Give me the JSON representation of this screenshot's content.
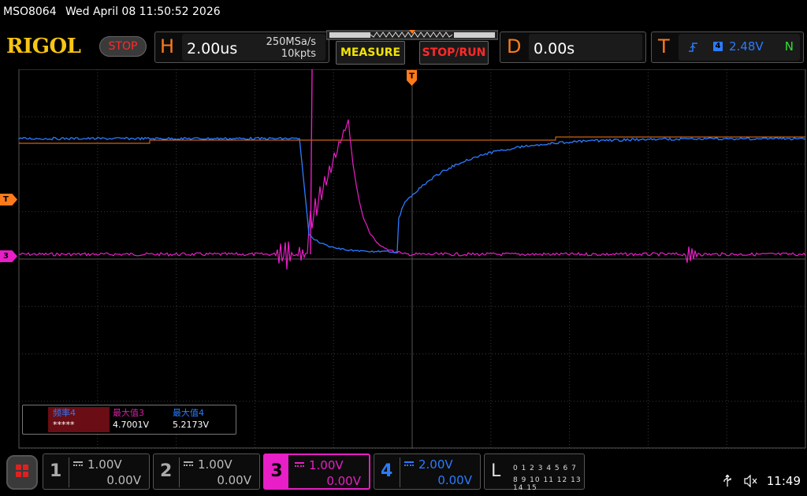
{
  "topline": {
    "model": "MSO8064",
    "datetime": "Wed April 08 11:50:52 2026"
  },
  "header": {
    "logo": "RIGOL",
    "run_state": "STOP",
    "horizontal": {
      "letter": "H",
      "scale": "2.00us",
      "sample_rate": "250MSa/s",
      "memory_depth": "10kpts"
    },
    "measure_label": "MEASURE",
    "stop_run_label": "STOP/RUN",
    "delay": {
      "letter": "D",
      "value": "0.00s"
    },
    "trigger": {
      "letter": "T",
      "source": "4",
      "level": "2.48V",
      "mode": "N"
    }
  },
  "markers": {
    "trigger_level": "T",
    "ch3_ground": "3"
  },
  "measurements": [
    {
      "label": "频率4",
      "value": "*****",
      "color": "#2b7bff"
    },
    {
      "label": "最大值3",
      "value": "4.7001V",
      "color": "#d81fa3"
    },
    {
      "label": "最大值4",
      "value": "5.2173V",
      "color": "#2b7bff"
    }
  ],
  "channels": [
    {
      "num": "1",
      "scale": "1.00V",
      "offset": "0.00V",
      "active": false,
      "color": "#bbbbbb"
    },
    {
      "num": "2",
      "scale": "1.00V",
      "offset": "0.00V",
      "active": false,
      "color": "#bbbbbb"
    },
    {
      "num": "3",
      "scale": "1.00V",
      "offset": "0.00V",
      "active": true,
      "color": "#e81ec6"
    },
    {
      "num": "4",
      "scale": "2.00V",
      "offset": "0.00V",
      "active": true,
      "color": "#2b7bff"
    }
  ],
  "logic": {
    "letter": "L",
    "row1": "0 1 2 3   4 5 6 7",
    "row2": "8 9 10 11  12 13 14 15"
  },
  "system": {
    "usb_icon": "usb-icon",
    "volume_icon": "mute-icon",
    "clock": "11:49"
  },
  "colors": {
    "ch3": "#e81ec6",
    "ch4": "#2b7bff",
    "trigger": "#ff7a1a",
    "logo": "#f7c513"
  }
}
